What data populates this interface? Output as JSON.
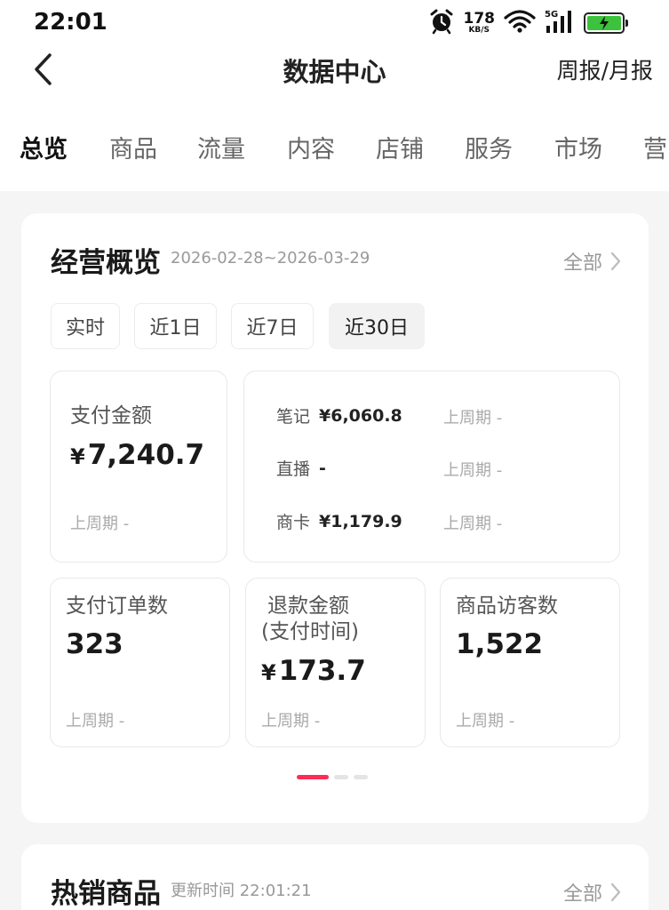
{
  "status": {
    "time": "22:01",
    "speed_value": "178",
    "speed_unit": "KB/S",
    "network": "5G"
  },
  "nav": {
    "title": "数据中心",
    "right": "周报/月报"
  },
  "tabs": [
    "总览",
    "商品",
    "流量",
    "内容",
    "店铺",
    "服务",
    "市场",
    "营"
  ],
  "overview": {
    "title": "经营概览",
    "date_range": "2026-02-28~2026-03-29",
    "all": "全部",
    "periods": [
      "实时",
      "近1日",
      "近7日",
      "近30日"
    ],
    "selected_period": "近30日",
    "pay_amount": {
      "label": "支付金额",
      "currency": "¥",
      "value": "7,240.7",
      "prev": "上周期 -"
    },
    "breakdown": [
      {
        "label": "笔记",
        "value": "¥6,060.8",
        "prev": "上周期 -"
      },
      {
        "label": "直播",
        "value": "-",
        "prev": "上周期 -"
      },
      {
        "label": "商卡",
        "value": "¥1,179.9",
        "prev": "上周期 -"
      }
    ],
    "orders": {
      "label": "支付订单数",
      "value": "323",
      "prev": "上周期 -"
    },
    "refund": {
      "label_line1": "退款金额",
      "label_line2": "(支付时间)",
      "currency": "¥",
      "value": "173.7",
      "prev": "上周期 -"
    },
    "visitors": {
      "label": "商品访客数",
      "value": "1,522",
      "prev": "上周期 -"
    },
    "page_count": 3,
    "page_active": 1
  },
  "hot": {
    "title": "热销商品",
    "update_time": "更新时间 22:01:21",
    "all": "全部"
  },
  "colors": {
    "accent": "#ff2c55",
    "battery": "#3cc23c",
    "background": "#f5f5f5"
  }
}
